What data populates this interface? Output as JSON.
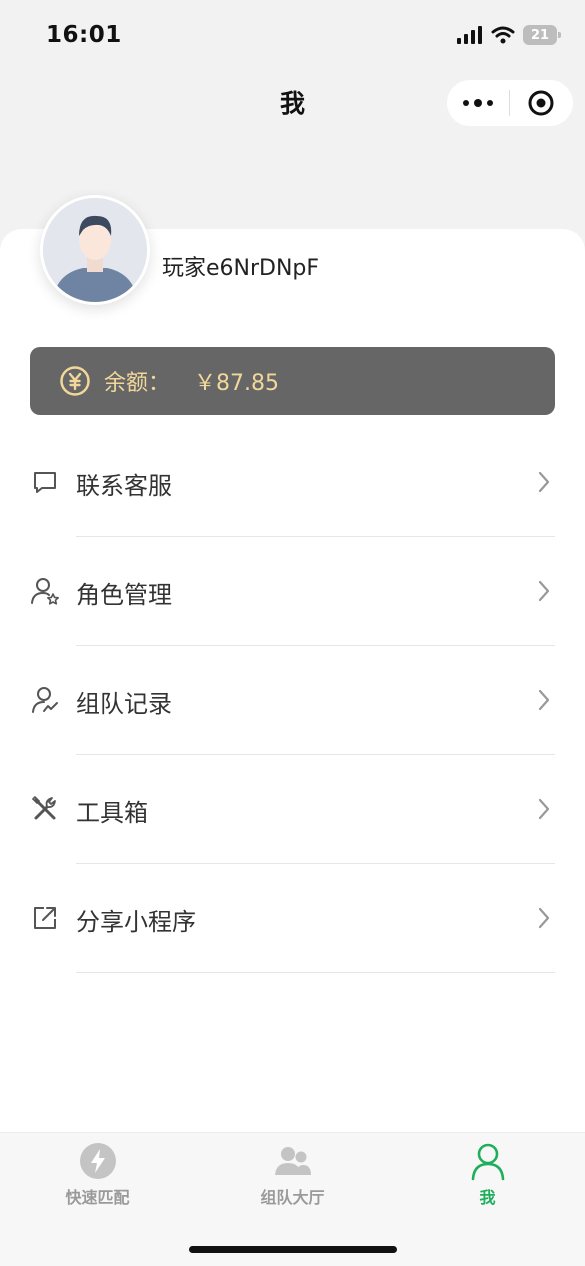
{
  "status": {
    "time": "16:01",
    "battery": "21"
  },
  "nav": {
    "title": "我"
  },
  "profile": {
    "username": "玩家e6NrDNpF"
  },
  "balance": {
    "label": "余额：",
    "value": "￥87.85"
  },
  "menu": [
    {
      "label": "联系客服",
      "icon": "message-icon"
    },
    {
      "label": "角色管理",
      "icon": "user-star-icon"
    },
    {
      "label": "组队记录",
      "icon": "user-history-icon"
    },
    {
      "label": "工具箱",
      "icon": "tools-icon"
    },
    {
      "label": "分享小程序",
      "icon": "share-icon"
    }
  ],
  "tabs": [
    {
      "label": "快速匹配",
      "icon": "lightning-icon",
      "active": false
    },
    {
      "label": "组队大厅",
      "icon": "users-icon",
      "active": false
    },
    {
      "label": "我",
      "icon": "person-icon",
      "active": true
    }
  ],
  "colors": {
    "accent": "#1fae5b",
    "balance_bg": "#666666",
    "balance_text": "#f1d79a"
  }
}
